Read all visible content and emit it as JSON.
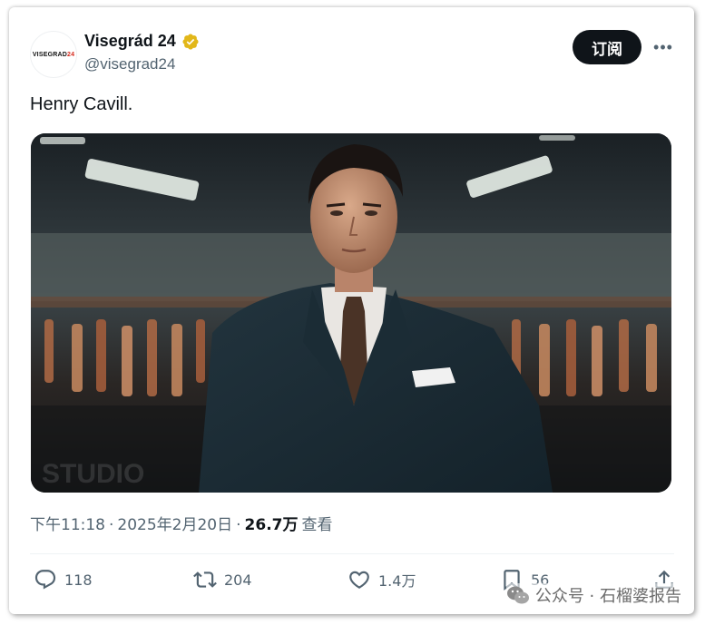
{
  "account": {
    "display_name": "Visegrád 24",
    "handle": "@visegrad24",
    "avatar_text": "VISEGRAD",
    "avatar_text_suffix": "24",
    "verified_color": "#e2b719"
  },
  "header": {
    "subscribe_label": "订阅",
    "more_label": "•••"
  },
  "tweet": {
    "text": "Henry Cavill.",
    "image_watermark": "STUDIO"
  },
  "meta": {
    "time": "下午11:18",
    "sep1": "·",
    "date": "2025年2月20日",
    "sep2": "·",
    "views": "26.7万",
    "views_label": "查看"
  },
  "actions": {
    "replies": "118",
    "reposts": "204",
    "likes": "1.4万",
    "bookmarks": "56"
  },
  "watermark": {
    "text": "公众号 · 石榴婆报告"
  },
  "colors": {
    "text_primary": "#0f1419",
    "text_secondary": "#536471",
    "button_bg": "#0f1419"
  }
}
